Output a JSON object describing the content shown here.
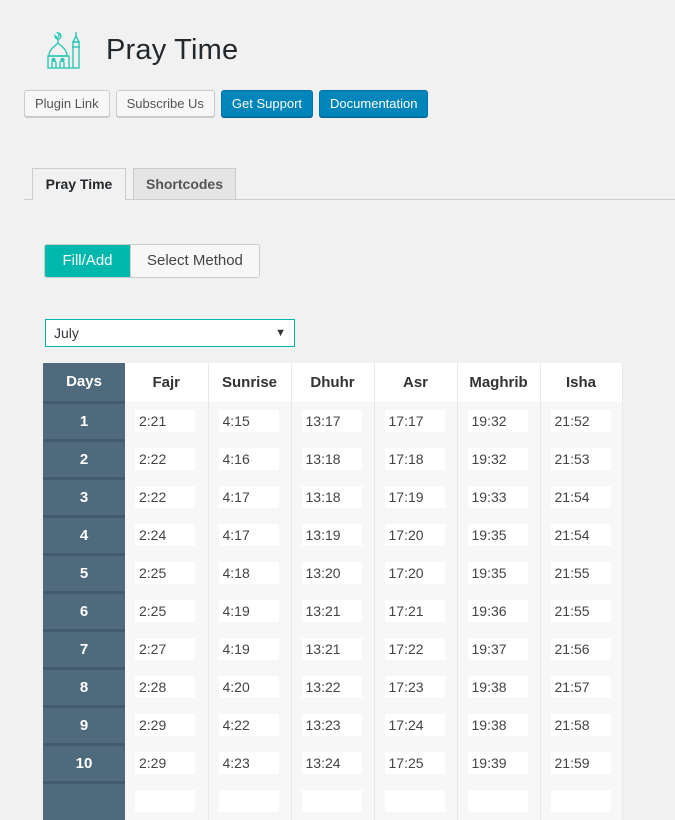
{
  "header": {
    "logo_icon": "mosque-icon",
    "title": "Pray Time"
  },
  "buttons": [
    {
      "label": "Plugin Link",
      "style": "secondary"
    },
    {
      "label": "Subscribe Us",
      "style": "secondary"
    },
    {
      "label": "Get Support",
      "style": "primary"
    },
    {
      "label": "Documentation",
      "style": "primary"
    }
  ],
  "tabs": [
    {
      "label": "Pray Time",
      "active": true
    },
    {
      "label": "Shortcodes",
      "active": false
    }
  ],
  "mode_toggle": {
    "options": [
      "Fill/Add",
      "Select Method"
    ],
    "selected": "Fill/Add"
  },
  "month_select": {
    "value": "July",
    "arrow": "▼"
  },
  "colors": {
    "accent_teal": "#00b9ac",
    "primary_blue": "#0085ba",
    "days_column": "#4f6a7d"
  },
  "table": {
    "headers": [
      "Days",
      "Fajr",
      "Sunrise",
      "Dhuhr",
      "Asr",
      "Maghrib",
      "Isha"
    ],
    "rows": [
      {
        "day": "1",
        "times": [
          "2:21",
          "4:15",
          "13:17",
          "17:17",
          "19:32",
          "21:52"
        ]
      },
      {
        "day": "2",
        "times": [
          "2:22",
          "4:16",
          "13:18",
          "17:18",
          "19:32",
          "21:53"
        ]
      },
      {
        "day": "3",
        "times": [
          "2:22",
          "4:17",
          "13:18",
          "17:19",
          "19:33",
          "21:54"
        ]
      },
      {
        "day": "4",
        "times": [
          "2:24",
          "4:17",
          "13:19",
          "17:20",
          "19:35",
          "21:54"
        ]
      },
      {
        "day": "5",
        "times": [
          "2:25",
          "4:18",
          "13:20",
          "17:20",
          "19:35",
          "21:55"
        ]
      },
      {
        "day": "6",
        "times": [
          "2:25",
          "4:19",
          "13:21",
          "17:21",
          "19:36",
          "21:55"
        ]
      },
      {
        "day": "7",
        "times": [
          "2:27",
          "4:19",
          "13:21",
          "17:22",
          "19:37",
          "21:56"
        ]
      },
      {
        "day": "8",
        "times": [
          "2:28",
          "4:20",
          "13:22",
          "17:23",
          "19:38",
          "21:57"
        ]
      },
      {
        "day": "9",
        "times": [
          "2:29",
          "4:22",
          "13:23",
          "17:24",
          "19:38",
          "21:58"
        ]
      },
      {
        "day": "10",
        "times": [
          "2:29",
          "4:23",
          "13:24",
          "17:25",
          "19:39",
          "21:59"
        ]
      },
      {
        "day": "",
        "times": [
          "",
          "",
          "",
          "",
          "",
          ""
        ]
      }
    ]
  }
}
